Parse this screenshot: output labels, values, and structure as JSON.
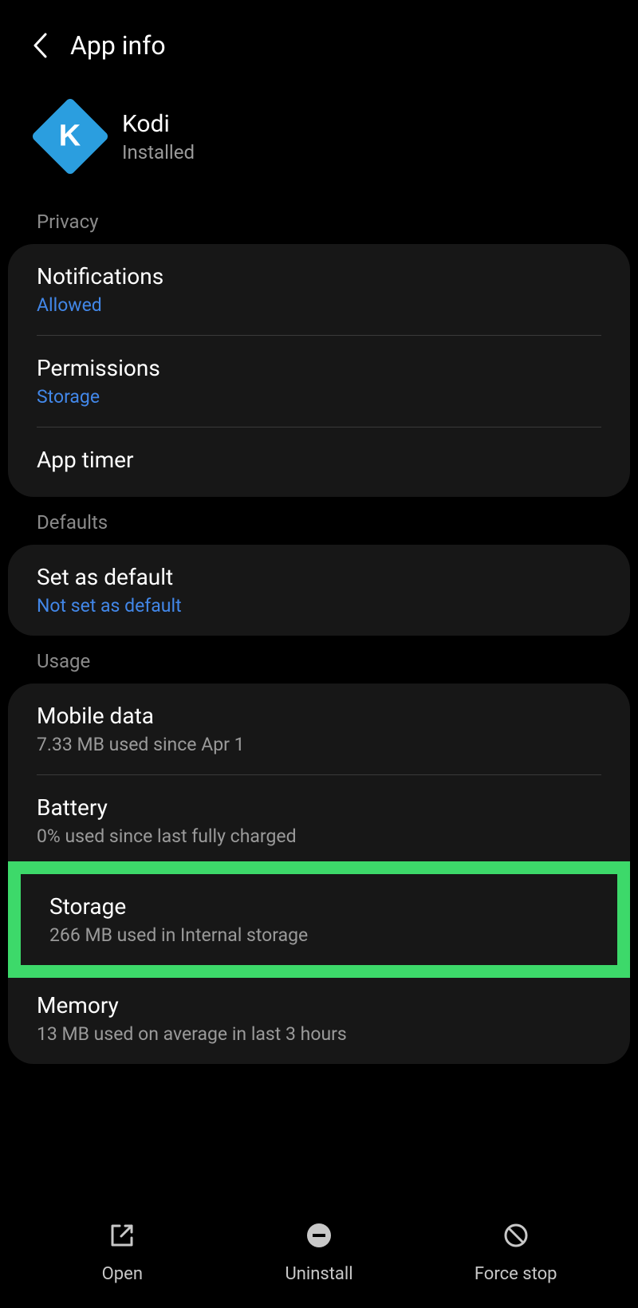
{
  "header": {
    "title": "App info"
  },
  "app": {
    "name": "Kodi",
    "status": "Installed",
    "icon_letter": "K"
  },
  "sections": {
    "privacy": {
      "label": "Privacy",
      "items": {
        "notifications": {
          "title": "Notifications",
          "value": "Allowed"
        },
        "permissions": {
          "title": "Permissions",
          "value": "Storage"
        },
        "app_timer": {
          "title": "App timer"
        }
      }
    },
    "defaults": {
      "label": "Defaults",
      "items": {
        "set_default": {
          "title": "Set as default",
          "value": "Not set as default"
        }
      }
    },
    "usage": {
      "label": "Usage",
      "items": {
        "mobile_data": {
          "title": "Mobile data",
          "value": "7.33 MB used since Apr 1"
        },
        "battery": {
          "title": "Battery",
          "value": "0% used since last fully charged"
        },
        "storage": {
          "title": "Storage",
          "value": "266 MB used in Internal storage"
        },
        "memory": {
          "title": "Memory",
          "value": "13 MB used on average in last 3 hours"
        }
      }
    }
  },
  "bottom_bar": {
    "open": "Open",
    "uninstall": "Uninstall",
    "force_stop": "Force stop"
  }
}
